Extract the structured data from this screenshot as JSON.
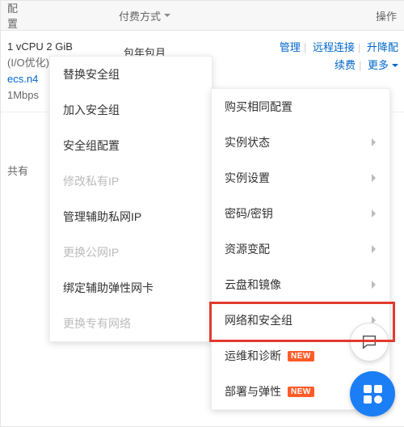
{
  "header": {
    "config": "配置",
    "billing": "付费方式",
    "ops": "操作"
  },
  "instance": {
    "spec_line": "1 vCPU 2 GiB",
    "io_opt": "(I/O优化)",
    "type_prefix": "ecs.n4",
    "bandwidth": "1Mbps",
    "billing_plan": "包年包月"
  },
  "ops": {
    "manage": "管理",
    "remote": "远程连接",
    "upgrade": "升降配",
    "renew": "续费",
    "more": "更多"
  },
  "shared_label": "共有",
  "submenu": {
    "items": [
      {
        "label": "替换安全组",
        "disabled": false
      },
      {
        "label": "加入安全组",
        "disabled": false
      },
      {
        "label": "安全组配置",
        "disabled": false
      },
      {
        "label": "修改私有IP",
        "disabled": true
      },
      {
        "label": "管理辅助私网IP",
        "disabled": false
      },
      {
        "label": "更换公网IP",
        "disabled": true
      },
      {
        "label": "绑定辅助弹性网卡",
        "disabled": false
      },
      {
        "label": "更换专有网络",
        "disabled": true
      }
    ]
  },
  "mainmenu": {
    "items": [
      {
        "label": "购买相同配置",
        "arrow": false,
        "badge": null
      },
      {
        "label": "实例状态",
        "arrow": true,
        "badge": null
      },
      {
        "label": "实例设置",
        "arrow": true,
        "badge": null
      },
      {
        "label": "密码/密钥",
        "arrow": true,
        "badge": null
      },
      {
        "label": "资源变配",
        "arrow": true,
        "badge": null
      },
      {
        "label": "云盘和镜像",
        "arrow": true,
        "badge": null
      },
      {
        "label": "网络和安全组",
        "arrow": true,
        "badge": null,
        "highlight": true
      },
      {
        "label": "运维和诊断",
        "arrow": true,
        "badge": "NEW"
      },
      {
        "label": "部署与弹性",
        "arrow": true,
        "badge": "NEW"
      }
    ]
  }
}
